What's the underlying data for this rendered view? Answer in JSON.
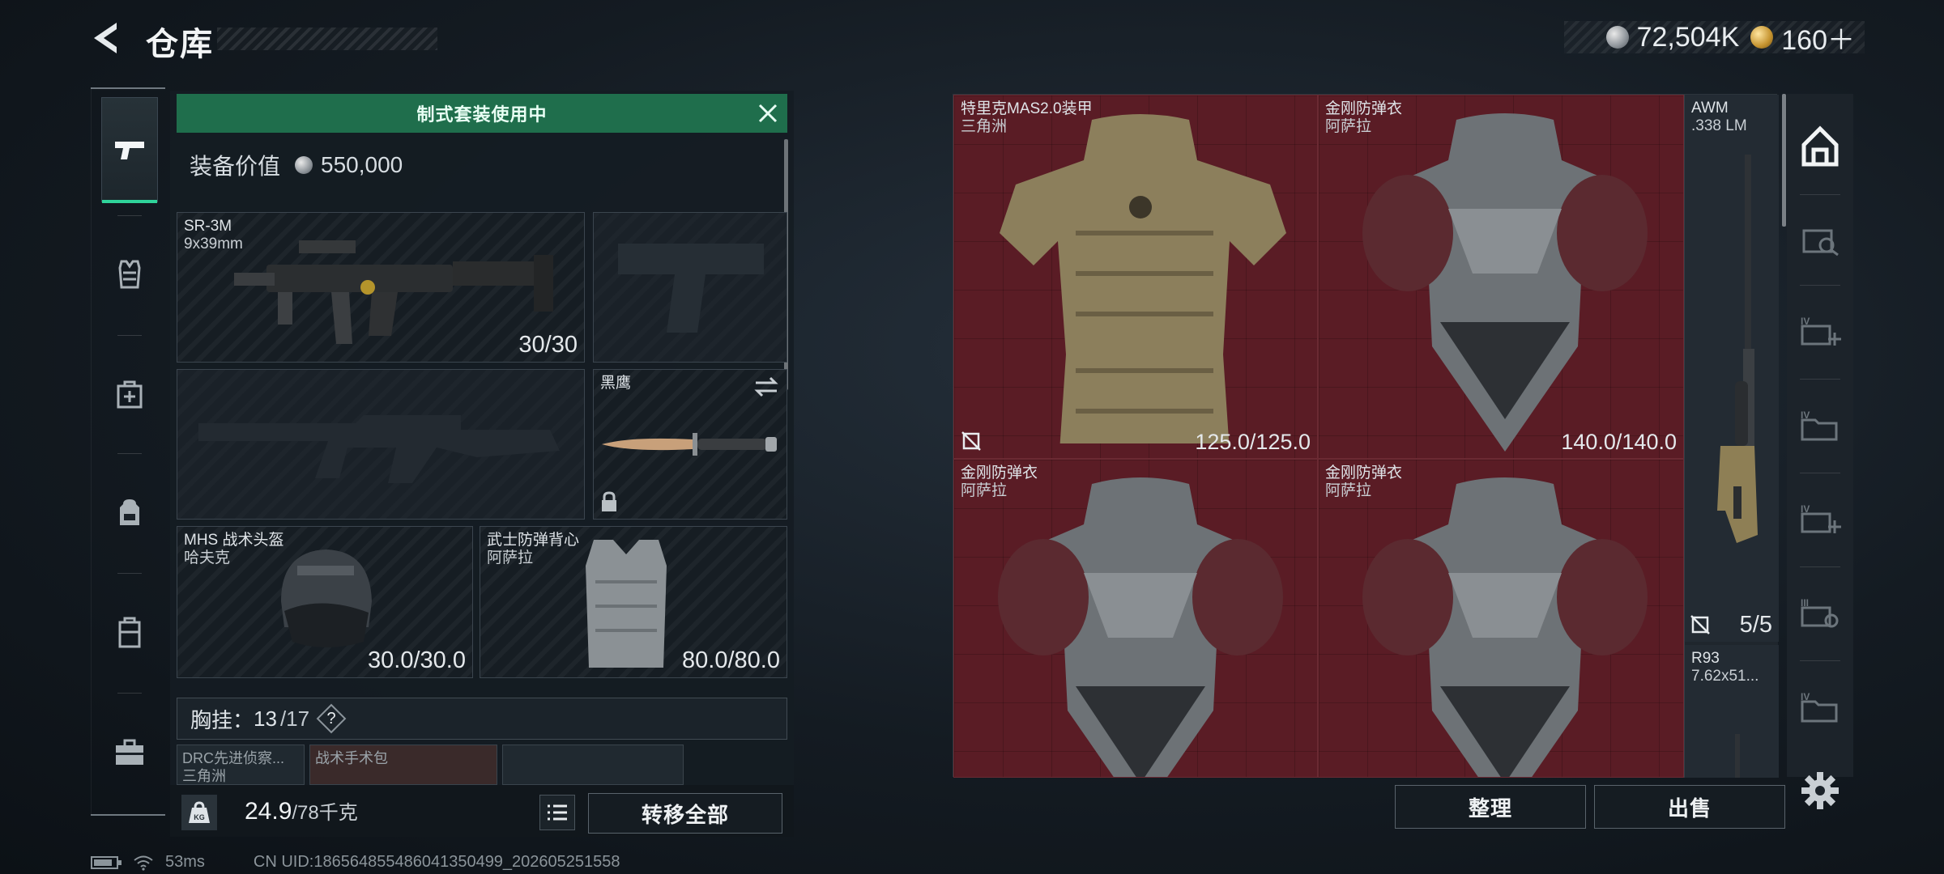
{
  "header": {
    "title": "仓库",
    "currencies": [
      {
        "icon": "silver-coin-icon",
        "value": "72,504K"
      },
      {
        "icon": "gold-coin-icon",
        "value": "160＋"
      }
    ]
  },
  "rail": {
    "items": [
      {
        "icon": "pistol-icon",
        "active": true
      },
      {
        "icon": "vest-icon",
        "active": false
      },
      {
        "icon": "medkit-icon",
        "active": false
      },
      {
        "icon": "backpack-icon",
        "active": false
      },
      {
        "icon": "case-icon",
        "active": false
      },
      {
        "icon": "toolbox-icon",
        "active": false
      }
    ]
  },
  "loadout": {
    "banner": "制式套装使用中",
    "value_label": "装备价值",
    "value": "550,000",
    "primary": {
      "name": "SR-3M",
      "ammo": "9x39mm",
      "count": "30/30"
    },
    "knife": {
      "name": "黑鹰"
    },
    "helmet": {
      "name": "MHS 战术头盔",
      "brand": "哈夫克",
      "durability": "30.0/30.0"
    },
    "armor": {
      "name": "武士防弹背心",
      "brand": "阿萨拉",
      "durability": "80.0/80.0"
    },
    "chest": {
      "label": "胸挂：",
      "used": "13",
      "cap": "/17",
      "help": "?"
    },
    "mini_items": [
      {
        "name": "DRC先进侦察...",
        "sub": "三角洲"
      },
      {
        "name": "战术手术包",
        "sub": ""
      },
      {
        "name": "",
        "sub": ""
      }
    ],
    "weight": "24.9",
    "weight_cap": "/78千克",
    "transfer_all": "转移全部"
  },
  "storage": {
    "cells": [
      {
        "name": "特里克MAS2.0装甲",
        "brand": "三角洲",
        "durability": "125.0/125.0"
      },
      {
        "name": "金刚防弹衣",
        "brand": "阿萨拉",
        "durability": "140.0/140.0"
      },
      {
        "name": "金刚防弹衣",
        "brand": "阿萨拉",
        "durability": ""
      },
      {
        "name": "金刚防弹衣",
        "brand": "阿萨拉",
        "durability": ""
      }
    ],
    "side": [
      {
        "name": "AWM",
        "sub": ".338 LM",
        "count": "5/5"
      },
      {
        "name": "R93",
        "sub": "7.62x51...",
        "count": ""
      }
    ],
    "sort": "整理",
    "sell": "出售"
  },
  "status": {
    "ping": "53ms",
    "uid": "CN UID:186564855486041350499_202605251558"
  }
}
